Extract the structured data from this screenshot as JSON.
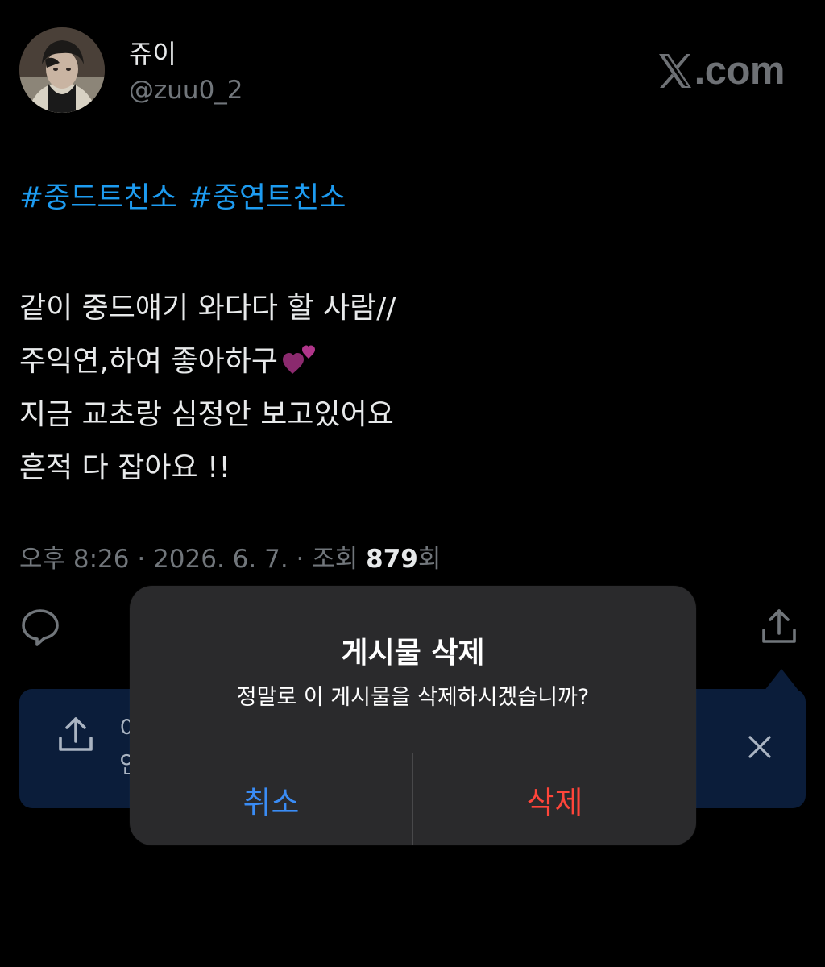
{
  "profile": {
    "display_name": "쥬이",
    "handle": "@zuu0_2",
    "avatar_icon": "profile-photo"
  },
  "brand": {
    "label": ".com",
    "icon": "x-logo-icon",
    "color": "#6e7175"
  },
  "tweet": {
    "hashtags": [
      "#중드트친소",
      "#중연트친소"
    ],
    "lines": [
      "같이 중드얘기 와다다 할 사람//",
      "주익연,하여 좋아하구",
      "지금 교초랑 심정안 보고있어요",
      "흔적 다 잡아요 !!"
    ],
    "emoji": "two-hearts-emoji",
    "meta_prefix": "오후 8:26 · 2026. 6. 7. · 조회 ",
    "view_count": "879",
    "meta_suffix": "회",
    "hashtag_color": "#1d9bf0"
  },
  "actions": {
    "reply_icon": "reply-icon",
    "share_icon": "share-icon"
  },
  "toast": {
    "text_line1": "이",
    "text_line2": "인",
    "share_icon": "share-icon",
    "close_icon": "close-icon"
  },
  "alert": {
    "title": "게시물 삭제",
    "message": "정말로 이 게시물을 삭제하시겠습니까?",
    "cancel_label": "취소",
    "delete_label": "삭제",
    "cancel_color": "#3a8cf5",
    "delete_color": "#ff453a"
  }
}
